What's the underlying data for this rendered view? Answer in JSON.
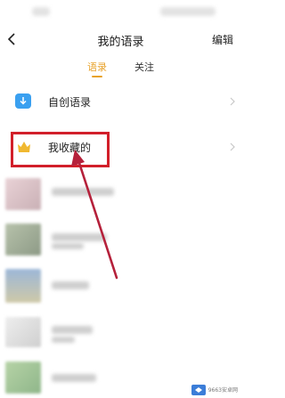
{
  "header": {
    "back_icon": "chevron-left-icon",
    "title": "我的语录",
    "edit_label": "编辑"
  },
  "tabs": [
    {
      "label": "语录",
      "active": true
    },
    {
      "label": "关注",
      "active": false
    }
  ],
  "menu": {
    "items": [
      {
        "label": "自创语录",
        "icon": "download-icon"
      },
      {
        "label": "我收藏的",
        "icon": "crown-icon"
      }
    ]
  },
  "annotation": {
    "highlight_color": "#d21f2a"
  },
  "colors": {
    "accent": "#e8a22a",
    "highlight": "#d21f2a",
    "icon_blue": "#3aa0f0"
  },
  "watermark": {
    "text": "9663安卓网"
  }
}
